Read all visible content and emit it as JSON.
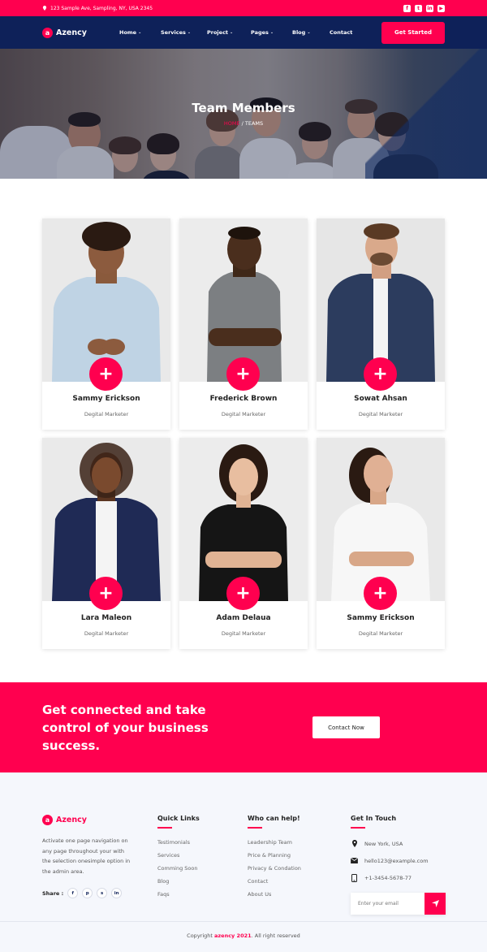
{
  "topbar": {
    "address": "123 Sample Ave, Sampling, NY, USA 2345",
    "socials": [
      {
        "icon": "facebook-icon",
        "glyph": "f"
      },
      {
        "icon": "twitter-icon",
        "glyph": "t"
      },
      {
        "icon": "linkedin-icon",
        "glyph": "in"
      },
      {
        "icon": "youtube-icon",
        "glyph": "▶"
      }
    ]
  },
  "nav": {
    "logo_mark": "a",
    "logo_text": "Azency",
    "items": [
      {
        "label": "Home",
        "dropdown": true
      },
      {
        "label": "Services",
        "dropdown": true
      },
      {
        "label": "Project",
        "dropdown": true
      },
      {
        "label": "Pages",
        "dropdown": true
      },
      {
        "label": "Blog",
        "dropdown": true
      },
      {
        "label": "Contact",
        "dropdown": false
      }
    ],
    "cta": "Get Started"
  },
  "hero": {
    "title": "Team Members",
    "crumb_home": "HOME",
    "crumb_sep": " / ",
    "crumb_current": "TEAMS"
  },
  "team": [
    {
      "name": "Sammy Erickson",
      "role": "Degital Marketer"
    },
    {
      "name": "Frederick Brown",
      "role": "Degital Marketer"
    },
    {
      "name": "Sowat Ahsan",
      "role": "Degital Marketer"
    },
    {
      "name": "Lara Maleon",
      "role": "Degital Marketer"
    },
    {
      "name": "Adam Delaua",
      "role": "Degital Marketer"
    },
    {
      "name": "Sammy Erickson",
      "role": "Degital Marketer"
    }
  ],
  "cta": {
    "text": "Get connected and take control of your business success.",
    "button": "Contact Now"
  },
  "footer": {
    "logo_mark": "a",
    "logo_text": "Azency",
    "description": "Activate one page navigation on any page throughout your with the selection onesimple option in the admin area.",
    "share_label": "Share :",
    "share_icons": [
      {
        "icon": "facebook-icon",
        "glyph": "f"
      },
      {
        "icon": "pinterest-icon",
        "glyph": "p"
      },
      {
        "icon": "skype-icon",
        "glyph": "s"
      },
      {
        "icon": "linkedin-icon",
        "glyph": "in"
      }
    ],
    "quick_links": {
      "title": "Quick Links",
      "links": [
        "Testimonials",
        "Services",
        "Comming Soon",
        "Blog",
        "Faqs"
      ]
    },
    "help": {
      "title": "Who can help!",
      "links": [
        "Leadership Team",
        "Price & Planning",
        "Privacy & Condation",
        "Contact",
        "About Us"
      ]
    },
    "touch": {
      "title": "Get In Touch",
      "location": "New York, USA",
      "email": "hello123@example.com",
      "phone": "+1-3454-5678-77",
      "email_placeholder": "Enter your email"
    },
    "copyright_pre": "Copyright ",
    "copyright_brand": "azency 2021",
    "copyright_post": ". All right reserved"
  },
  "colors": {
    "accent": "#ff004f",
    "navy": "#0e2159",
    "footer_bg": "#f5f7fc"
  }
}
